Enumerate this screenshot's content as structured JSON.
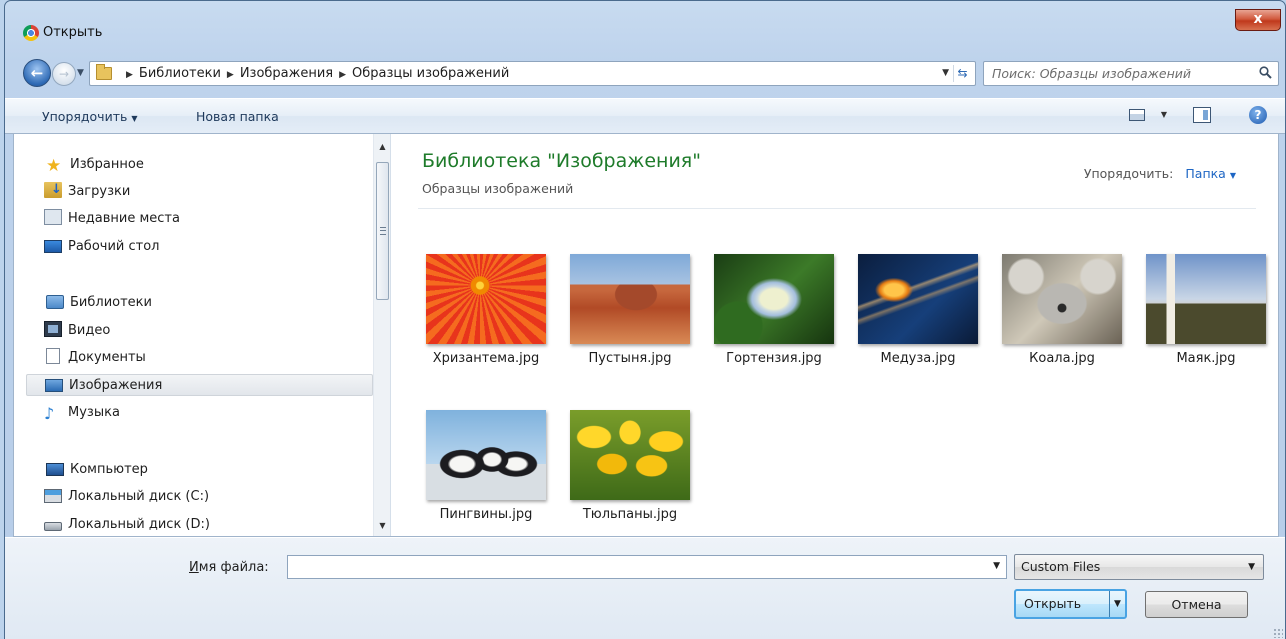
{
  "window": {
    "title": "Открыть",
    "close_label": "x"
  },
  "address_bar": {
    "crumbs": [
      "Библиотеки",
      "Изображения",
      "Образцы изображений"
    ],
    "search_placeholder": "Поиск: Образцы изображений"
  },
  "toolbar": {
    "organize_label": "Упорядочить",
    "new_folder_label": "Новая папка"
  },
  "sidebar": {
    "groups": [
      {
        "label": "Избранное",
        "items": [
          "Загрузки",
          "Недавние места",
          "Рабочий стол"
        ]
      },
      {
        "label": "Библиотеки",
        "items": [
          "Видео",
          "Документы",
          "Изображения",
          "Музыка"
        ]
      },
      {
        "label": "Компьютер",
        "items": [
          "Локальный диск (C:)",
          "Локальный диск (D:)"
        ]
      }
    ],
    "selected": "Изображения"
  },
  "main": {
    "library_title": "Библиотека \"Изображения\"",
    "subtitle": "Образцы изображений",
    "arrange_label": "Упорядочить:",
    "arrange_value": "Папка",
    "files": [
      {
        "name": "Хризантема.jpg"
      },
      {
        "name": "Пустыня.jpg"
      },
      {
        "name": "Гортензия.jpg"
      },
      {
        "name": "Медуза.jpg"
      },
      {
        "name": "Коала.jpg"
      },
      {
        "name": "Маяк.jpg"
      },
      {
        "name": "Пингвины.jpg"
      },
      {
        "name": "Тюльпаны.jpg"
      }
    ]
  },
  "footer": {
    "filename_label": "Имя файла:",
    "filename_value": "",
    "filetype_value": "Custom Files",
    "open_label": "Открыть",
    "cancel_label": "Отмена"
  }
}
